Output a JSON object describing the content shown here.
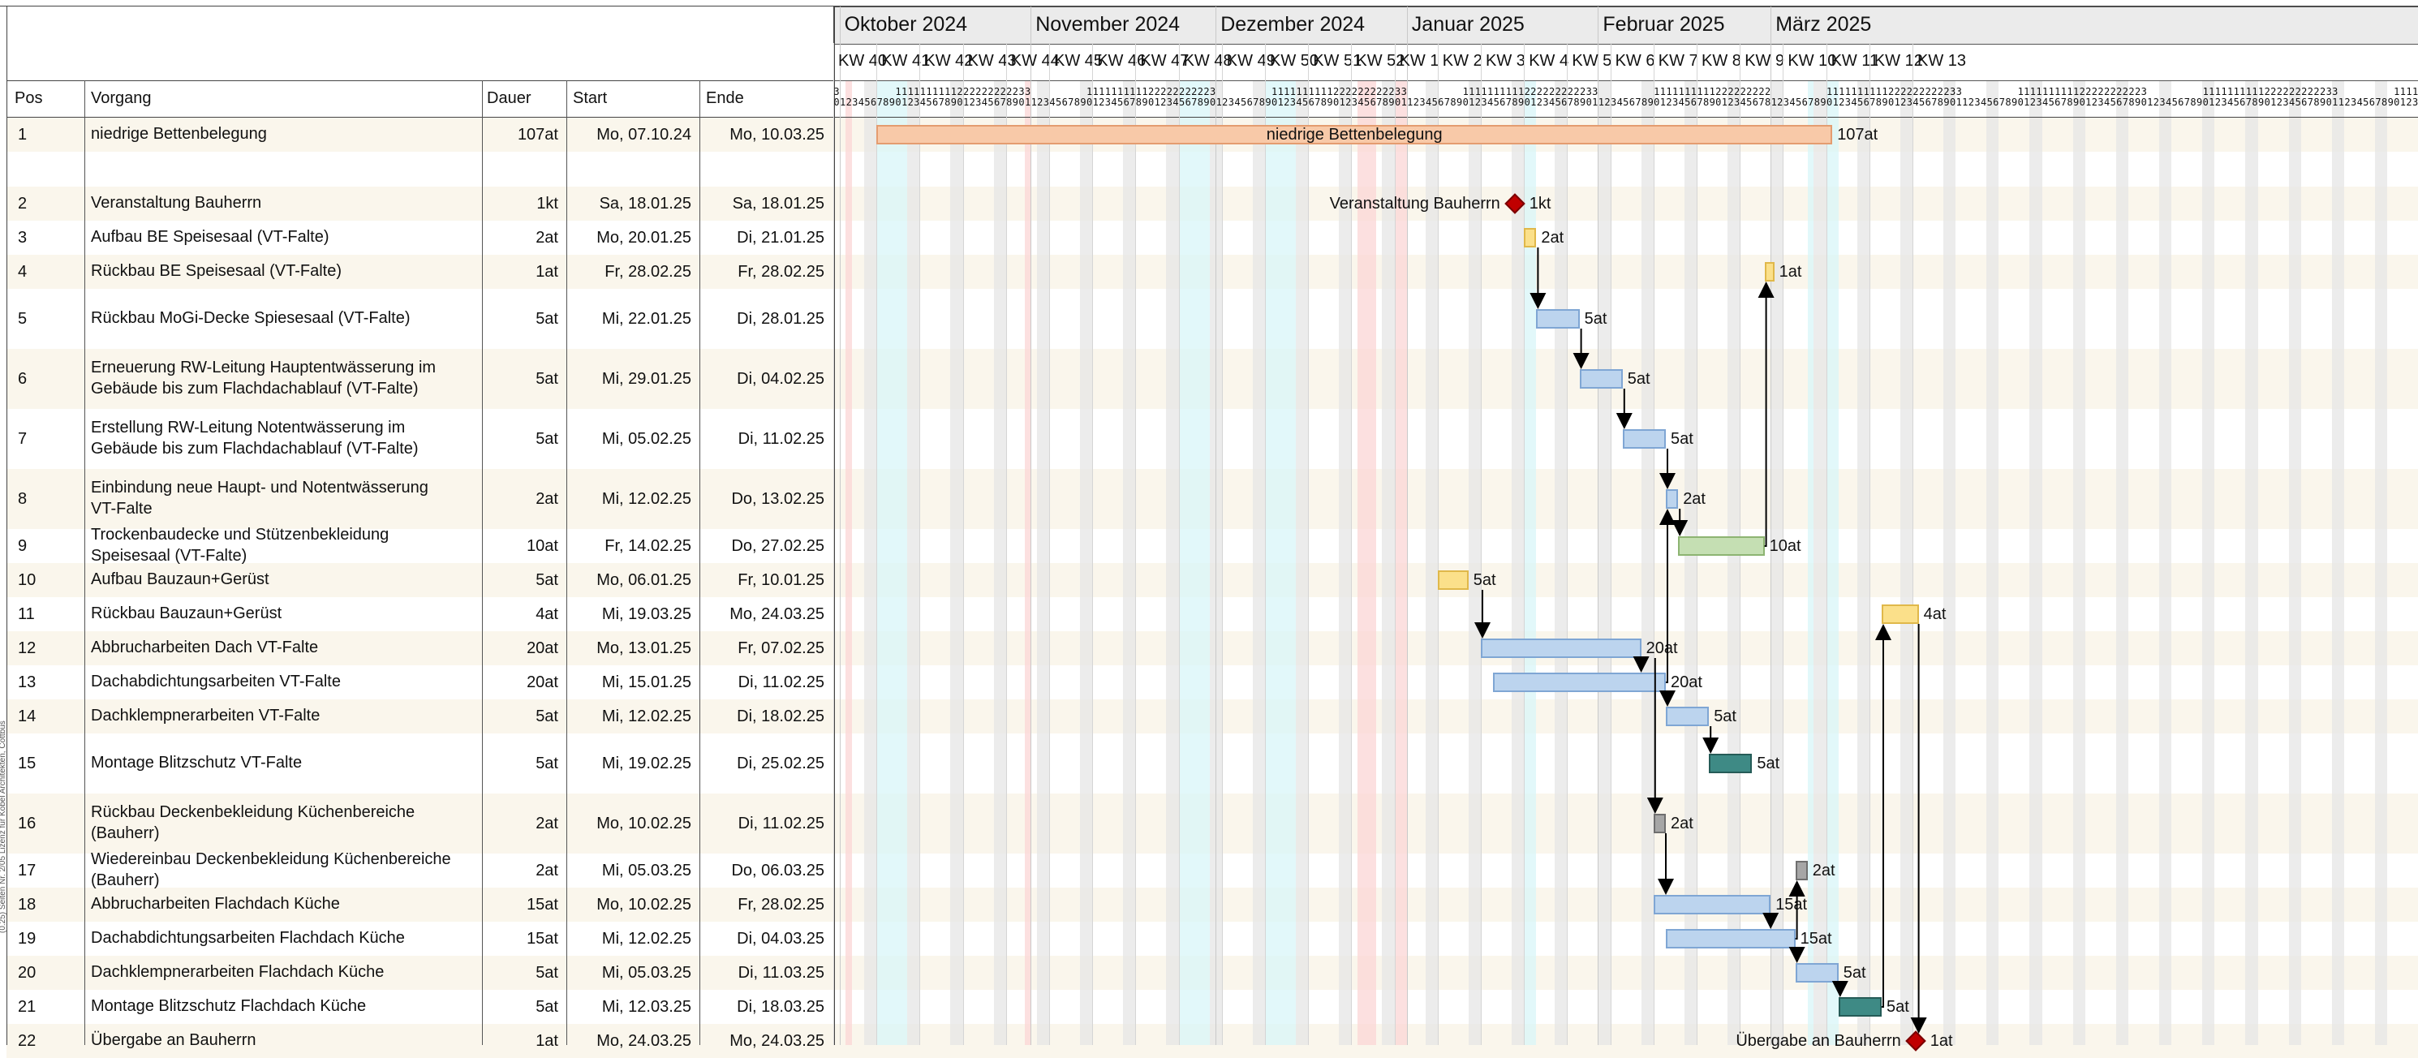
{
  "table_headers": {
    "pos": "Pos",
    "task": "Vorgang",
    "duration": "Dauer",
    "start": "Start",
    "end": "Ende"
  },
  "months": [
    "Oktober 2024",
    "November 2024",
    "Dezember 2024",
    "Januar 2025",
    "Februar 2025",
    "März 2025"
  ],
  "weeks": [
    "KW 40",
    "KW 41",
    "KW 42",
    "KW 43",
    "KW 44",
    "KW 45",
    "KW 46",
    "KW 47",
    "KW 48",
    "KW 49",
    "KW 50",
    "KW 51",
    "KW 52",
    "KW 1",
    "KW 2",
    "KW 3",
    "KW 4",
    "KW 5",
    "KW 6",
    "KW 7",
    "KW 8",
    "KW 9",
    "KW 10",
    "KW 11",
    "KW 12",
    "KW 13"
  ],
  "tasks": [
    {
      "pos": "1",
      "name": [
        "niedrige Bettenbelegung"
      ],
      "dur": "107at",
      "start": "Mo, 07.10.24",
      "end": "Mo, 10.03.25",
      "bar_label": "niedrige Bettenbelegung",
      "dur_label": "107at",
      "color": "#f8c9a8"
    },
    {
      "pos": "",
      "name": [
        ""
      ],
      "dur": "",
      "start": "",
      "end": ""
    },
    {
      "pos": "2",
      "name": [
        "Veranstaltung Bauherrn"
      ],
      "dur": "1kt",
      "start": "Sa, 18.01.25",
      "end": "Sa, 18.01.25",
      "bar_label": "Veranstaltung Bauherrn",
      "dur_label": "1kt"
    },
    {
      "pos": "3",
      "name": [
        "Aufbau BE Speisesaal (VT-Falte)"
      ],
      "dur": "2at",
      "start": "Mo, 20.01.25",
      "end": "Di, 21.01.25",
      "dur_label": "2at",
      "color": "#fbe08a"
    },
    {
      "pos": "4",
      "name": [
        "Rückbau BE Speisesaal (VT-Falte)"
      ],
      "dur": "1at",
      "start": "Fr, 28.02.25",
      "end": "Fr, 28.02.25",
      "dur_label": "1at",
      "color": "#fbe08a"
    },
    {
      "pos": "5",
      "name": [
        "Rückbau MoGi-Decke Spiesesaal (VT-Falte)"
      ],
      "dur": "5at",
      "start": "Mi, 22.01.25",
      "end": "Di, 28.01.25",
      "dur_label": "5at",
      "color": "#bcd4ee"
    },
    {
      "pos": "6",
      "name": [
        "Erneuerung RW-Leitung Hauptentwässerung im",
        "Gebäude bis zum Flachdachablauf (VT-Falte)"
      ],
      "dur": "5at",
      "start": "Mi, 29.01.25",
      "end": "Di, 04.02.25",
      "dur_label": "5at",
      "color": "#bcd4ee"
    },
    {
      "pos": "7",
      "name": [
        "Erstellung RW-Leitung Notentwässerung im",
        "Gebäude bis zum Flachdachablauf (VT-Falte)"
      ],
      "dur": "5at",
      "start": "Mi, 05.02.25",
      "end": "Di, 11.02.25",
      "dur_label": "5at",
      "color": "#bcd4ee"
    },
    {
      "pos": "8",
      "name": [
        "Einbindung neue Haupt- und Notentwässerung",
        "VT-Falte"
      ],
      "dur": "2at",
      "start": "Mi, 12.02.25",
      "end": "Do, 13.02.25",
      "dur_label": "2at",
      "color": "#bcd4ee"
    },
    {
      "pos": "9",
      "name": [
        "Trockenbaudecke und Stützenbekleidung",
        "Speisesaal  (VT-Falte)"
      ],
      "dur": "10at",
      "start": "Fr, 14.02.25",
      "end": "Do, 27.02.25",
      "dur_label": "10at",
      "color": "#c5dfb3"
    },
    {
      "pos": "10",
      "name": [
        "Aufbau Bauzaun+Gerüst"
      ],
      "dur": "5at",
      "start": "Mo, 06.01.25",
      "end": "Fr, 10.01.25",
      "dur_label": "5at",
      "color": "#fbe08a"
    },
    {
      "pos": "11",
      "name": [
        "Rückbau Bauzaun+Gerüst"
      ],
      "dur": "4at",
      "start": "Mi, 19.03.25",
      "end": "Mo, 24.03.25",
      "dur_label": "4at",
      "color": "#fbe08a"
    },
    {
      "pos": "12",
      "name": [
        "Abbrucharbeiten Dach VT-Falte"
      ],
      "dur": "20at",
      "start": "Mo, 13.01.25",
      "end": "Fr, 07.02.25",
      "dur_label": "20at",
      "color": "#bcd4ee"
    },
    {
      "pos": "13",
      "name": [
        "Dachabdichtungsarbeiten VT-Falte"
      ],
      "dur": "20at",
      "start": "Mi, 15.01.25",
      "end": "Di, 11.02.25",
      "dur_label": "20at",
      "color": "#bcd4ee"
    },
    {
      "pos": "14",
      "name": [
        "Dachklempnerarbeiten VT-Falte"
      ],
      "dur": "5at",
      "start": "Mi, 12.02.25",
      "end": "Di, 18.02.25",
      "dur_label": "5at",
      "color": "#bcd4ee"
    },
    {
      "pos": "15",
      "name": [
        "Montage Blitzschutz VT-Falte"
      ],
      "dur": "5at",
      "start": "Mi, 19.02.25",
      "end": "Di, 25.02.25",
      "dur_label": "5at",
      "color": "#3e8a85"
    },
    {
      "pos": "16",
      "name": [
        "Rückbau Deckenbekleidung Küchenbereiche",
        "(Bauherr)"
      ],
      "dur": "2at",
      "start": "Mo, 10.02.25",
      "end": "Di, 11.02.25",
      "dur_label": "2at",
      "color": "#a6a6a6"
    },
    {
      "pos": "17",
      "name": [
        "Wiedereinbau Deckenbekleidung Küchenbereiche",
        "(Bauherr)"
      ],
      "dur": "2at",
      "start": "Mi, 05.03.25",
      "end": "Do, 06.03.25",
      "dur_label": "2at",
      "color": "#a6a6a6"
    },
    {
      "pos": "18",
      "name": [
        "Abbrucharbeiten Flachdach Küche"
      ],
      "dur": "15at",
      "start": "Mo, 10.02.25",
      "end": "Fr, 28.02.25",
      "dur_label": "15at",
      "color": "#bcd4ee"
    },
    {
      "pos": "19",
      "name": [
        "Dachabdichtungsarbeiten Flachdach Küche"
      ],
      "dur": "15at",
      "start": "Mi, 12.02.25",
      "end": "Di, 04.03.25",
      "dur_label": "15at",
      "color": "#bcd4ee"
    },
    {
      "pos": "20",
      "name": [
        "Dachklempnerarbeiten Flachdach Küche"
      ],
      "dur": "5at",
      "start": "Mi, 05.03.25",
      "end": "Di, 11.03.25",
      "dur_label": "5at",
      "color": "#bcd4ee"
    },
    {
      "pos": "21",
      "name": [
        "Montage Blitzschutz Flachdach Küche"
      ],
      "dur": "5at",
      "start": "Mi, 12.03.25",
      "end": "Di, 18.03.25",
      "dur_label": "5at",
      "color": "#3e8a85"
    },
    {
      "pos": "22",
      "name": [
        "Übergabe an Bauherrn"
      ],
      "dur": "1at",
      "start": "Mo, 24.03.25",
      "end": "Mo, 24.03.25",
      "bar_label": "Übergabe an Bauherrn",
      "dur_label": "1at"
    }
  ],
  "side_text": "(0.25)  Seiten Nr. 2/05  Lizenz für Kobel Architekten, Cottbus",
  "colors": {
    "weekend": "#e6e6e6",
    "holiday": "#fbd5d5",
    "vacation": "#d8f6f8",
    "row_alt": "#faf6ec",
    "grid": "#888888",
    "header_bg": "#ebebeb"
  }
}
